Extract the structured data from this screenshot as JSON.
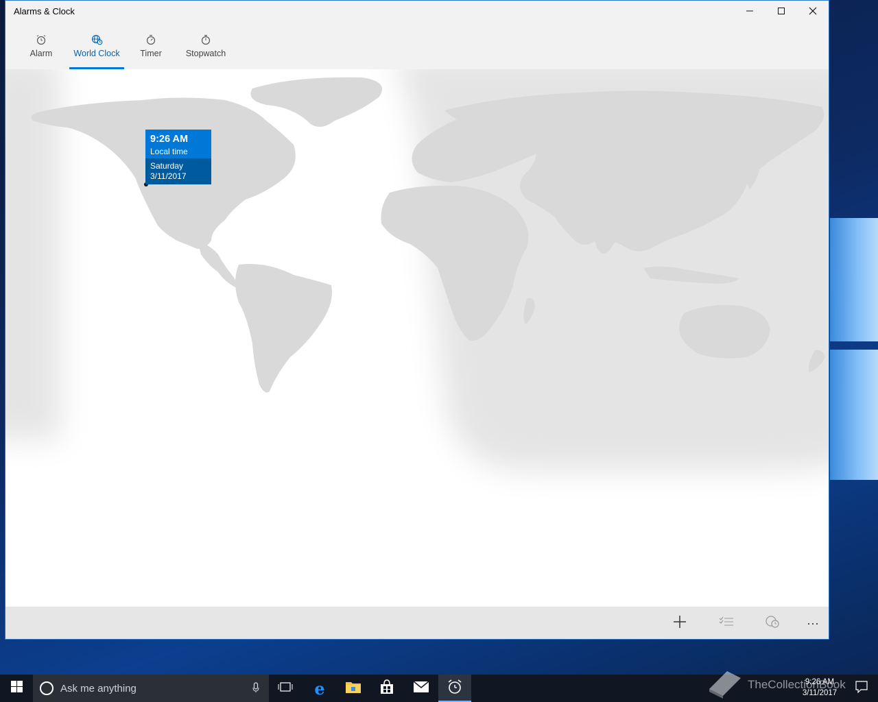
{
  "window": {
    "title": "Alarms & Clock",
    "controls": {
      "minimize": "–",
      "maximize": "☐",
      "close": "✕"
    }
  },
  "tabs": [
    {
      "label": "Alarm",
      "icon": "alarm-clock-icon",
      "active": false
    },
    {
      "label": "World Clock",
      "icon": "globe-clock-icon",
      "active": true
    },
    {
      "label": "Timer",
      "icon": "timer-icon",
      "active": false
    },
    {
      "label": "Stopwatch",
      "icon": "stopwatch-icon",
      "active": false
    }
  ],
  "popup": {
    "time": "9:26 AM",
    "label": "Local time",
    "day": "Saturday",
    "date": "3/11/2017"
  },
  "command_bar": {
    "add": "+",
    "select": "select-icon",
    "compare": "compare-icon",
    "more": "···"
  },
  "taskbar": {
    "search_placeholder": "Ask me anything",
    "clock_time": "9:26 AM",
    "clock_date": "3/11/2017",
    "watermark": "TheCollectionBook"
  },
  "colors": {
    "accent": "#0078d7",
    "accent_dark": "#005a9e",
    "land": "#d9d9d9",
    "night": "#e6e6e6"
  }
}
